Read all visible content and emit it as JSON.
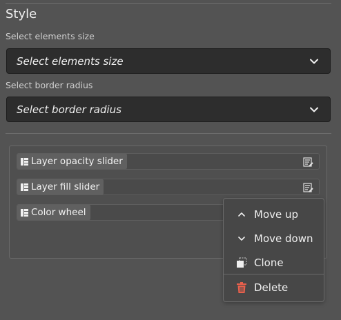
{
  "style": {
    "title": "Style",
    "size_label": "Select elements size",
    "size_select": {
      "value": "Select elements size"
    },
    "radius_label": "Select border radius",
    "radius_select": {
      "value": "Select border radius"
    }
  },
  "items": [
    {
      "label": "Layer opacity slider"
    },
    {
      "label": "Layer fill slider"
    },
    {
      "label": "Color wheel"
    }
  ],
  "context_menu": {
    "move_up": "Move up",
    "move_down": "Move down",
    "clone": "Clone",
    "delete": "Delete"
  },
  "colors": {
    "background": "#535353",
    "select_bg": "#2d2d2d",
    "delete_icon": "#e8604c"
  },
  "icons": {
    "dropdown": "chevron-down-icon",
    "grip": "drag-grip-icon",
    "edit": "edit-list-icon",
    "move_up": "chevron-up-icon",
    "move_down": "chevron-down-icon",
    "clone": "clone-icon",
    "delete": "trash-icon"
  }
}
